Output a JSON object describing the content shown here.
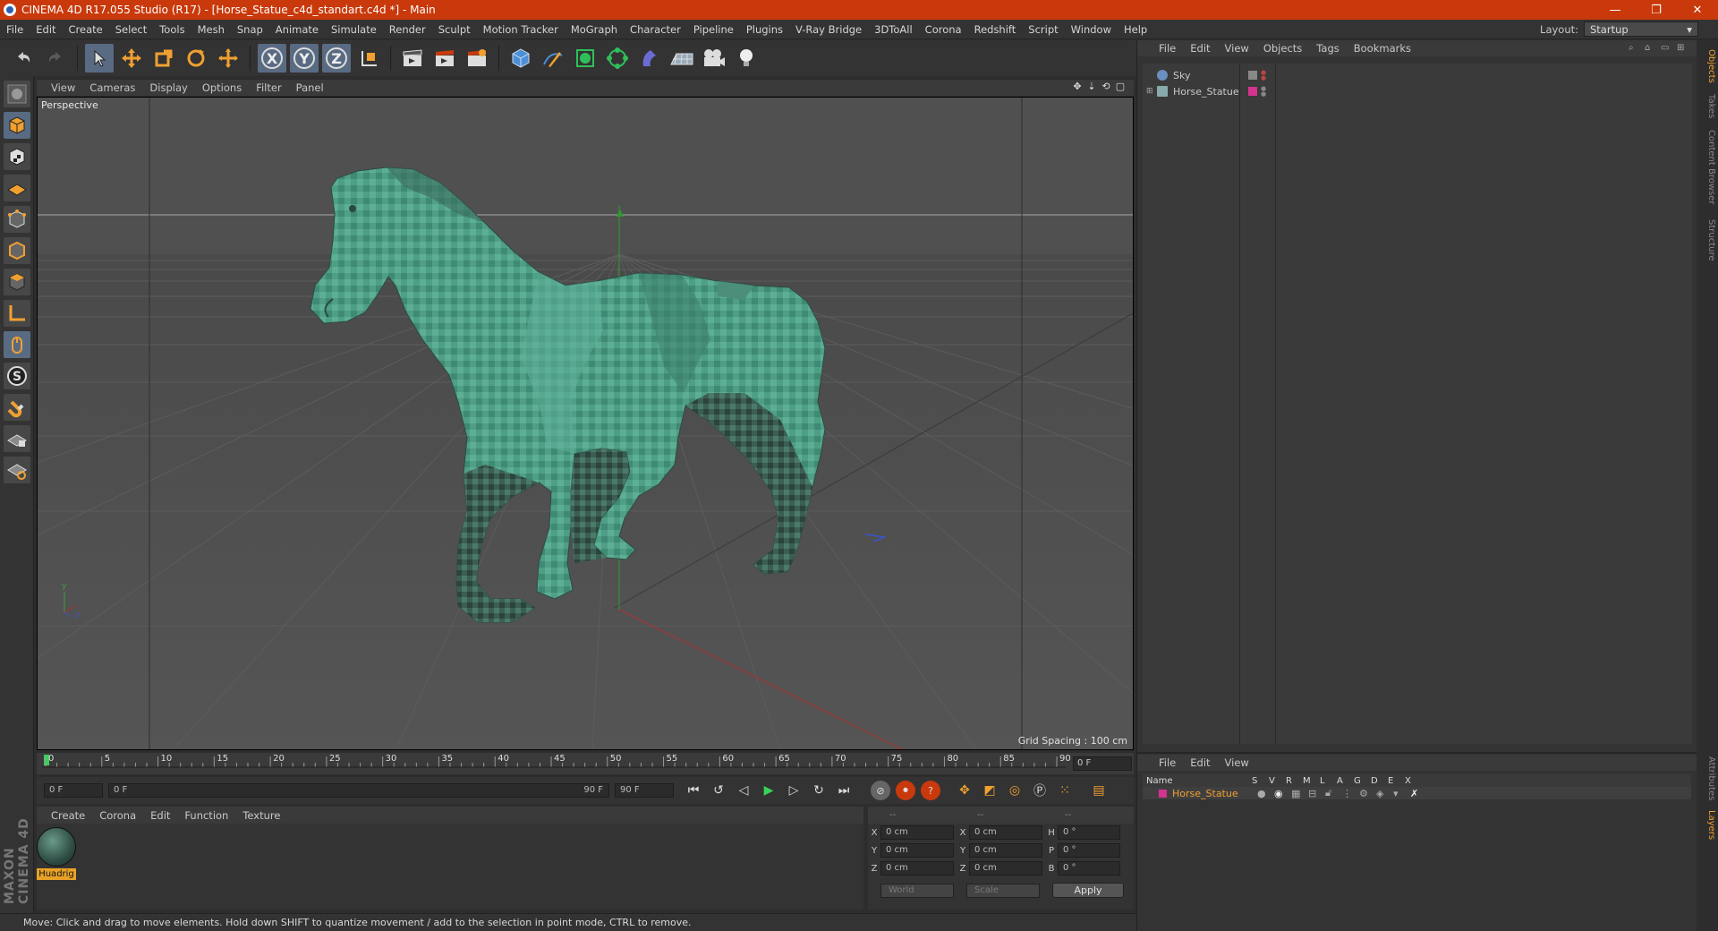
{
  "title_bar": {
    "title": "CINEMA 4D R17.055 Studio (R17) - [Horse_Statue_c4d_standart.c4d *] - Main",
    "minimize": "—",
    "restore": "❐",
    "close": "✕"
  },
  "menu": [
    "File",
    "Edit",
    "Create",
    "Select",
    "Tools",
    "Mesh",
    "Snap",
    "Animate",
    "Simulate",
    "Render",
    "Sculpt",
    "Motion Tracker",
    "MoGraph",
    "Character",
    "Pipeline",
    "Plugins",
    "V-Ray Bridge",
    "3DToAll",
    "Corona",
    "Redshift",
    "Script",
    "Window",
    "Help"
  ],
  "layout": {
    "label": "Layout:",
    "value": "Startup"
  },
  "toolbar": {
    "x_axis": "X",
    "y_axis": "Y",
    "z_axis": "Z"
  },
  "viewport": {
    "menu": [
      "View",
      "Cameras",
      "Display",
      "Options",
      "Filter",
      "Panel"
    ],
    "label": "Perspective",
    "grid_spacing": "Grid Spacing : 100 cm"
  },
  "timeline": {
    "ticks": [
      "0",
      "5",
      "10",
      "15",
      "20",
      "25",
      "30",
      "35",
      "40",
      "45",
      "50",
      "55",
      "60",
      "65",
      "70",
      "75",
      "80",
      "85",
      "90"
    ],
    "current_frame": "0 F",
    "start_frame": "0 F",
    "range_start": "0 F",
    "range_end": "90 F",
    "end_frame": "90 F"
  },
  "material_manager": {
    "menu": [
      "Create",
      "Corona",
      "Edit",
      "Function",
      "Texture"
    ],
    "material_name": "Huadrig"
  },
  "coordinates": {
    "headers": [
      "--",
      "--",
      "--"
    ],
    "rows": [
      {
        "a": "X",
        "av": "0 cm",
        "b": "X",
        "bv": "0 cm",
        "c": "H",
        "cv": "0 °"
      },
      {
        "a": "Y",
        "av": "0 cm",
        "b": "Y",
        "bv": "0 cm",
        "c": "P",
        "cv": "0 °"
      },
      {
        "a": "Z",
        "av": "0 cm",
        "b": "Z",
        "bv": "0 cm",
        "c": "B",
        "cv": "0 °"
      }
    ],
    "world": "World",
    "scale": "Scale",
    "apply": "Apply"
  },
  "object_manager": {
    "menu": [
      "File",
      "Edit",
      "View",
      "Objects",
      "Tags",
      "Bookmarks"
    ],
    "objects": [
      {
        "name": "Sky",
        "color": "#6a8fc0"
      },
      {
        "name": "Horse_Statue",
        "color": "#d3348d"
      }
    ]
  },
  "layer_manager": {
    "menu": [
      "File",
      "Edit",
      "View"
    ],
    "columns": [
      "Name",
      "S",
      "V",
      "R",
      "M",
      "L",
      "A",
      "G",
      "D",
      "E",
      "X"
    ],
    "layer_name": "Horse_Statue"
  },
  "side_tabs": [
    "Objects",
    "Takes",
    "Content Browser",
    "Structure"
  ],
  "side_tabs_lower": [
    "Attributes",
    "Layers"
  ],
  "branding": "MAXON CINEMA 4D",
  "status_text": "Move: Click and drag to move elements. Hold down SHIFT to quantize movement / add to the selection in point mode, CTRL to remove.",
  "colors": {
    "titlebar": "#c9390b",
    "accent": "#f0a030",
    "selected": "#596b82",
    "horse": "#4f9e86"
  }
}
